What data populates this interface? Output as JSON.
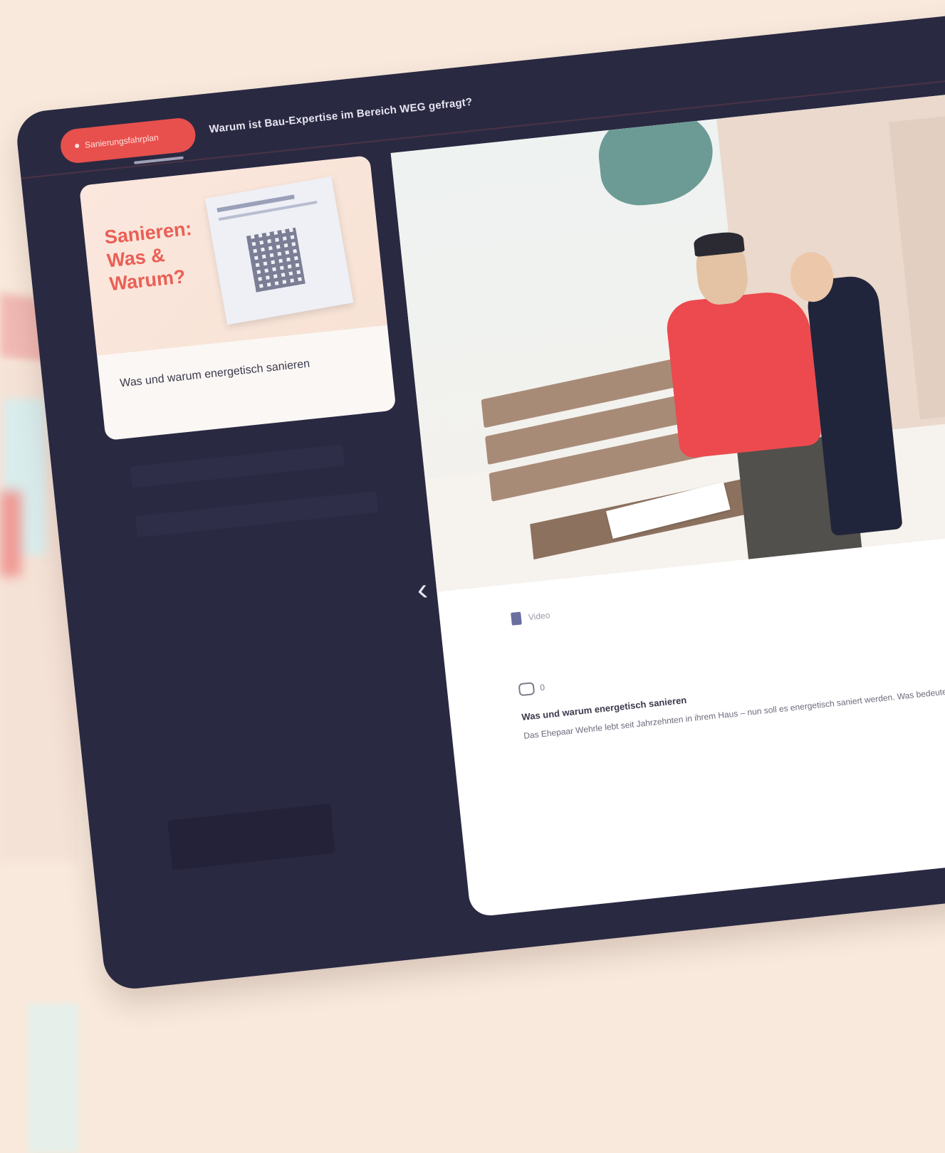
{
  "header": {
    "pill_label": "Sanierungsfahrplan",
    "title": "Warum ist Bau-Expertise im Bereich WEG gefragt?"
  },
  "sidebar": {
    "card": {
      "thumb_title": "Sanieren: Was & Warum?",
      "caption": "Was und warum energetisch sanieren"
    }
  },
  "main": {
    "meta_label": "Video",
    "comment_count": "0",
    "post_title": "Was und warum energetisch sanieren",
    "post_text": "Das Ehepaar Wehrle lebt seit Jahrzehnten in ihrem Haus – nun soll es energetisch saniert werden. Was bedeutet das für sie?"
  },
  "colors": {
    "background": "#f8e9dc",
    "device": "#2a2942",
    "accent": "#e8504d"
  },
  "icons": [
    "back-chevron-icon",
    "document-icon",
    "comment-icon"
  ]
}
